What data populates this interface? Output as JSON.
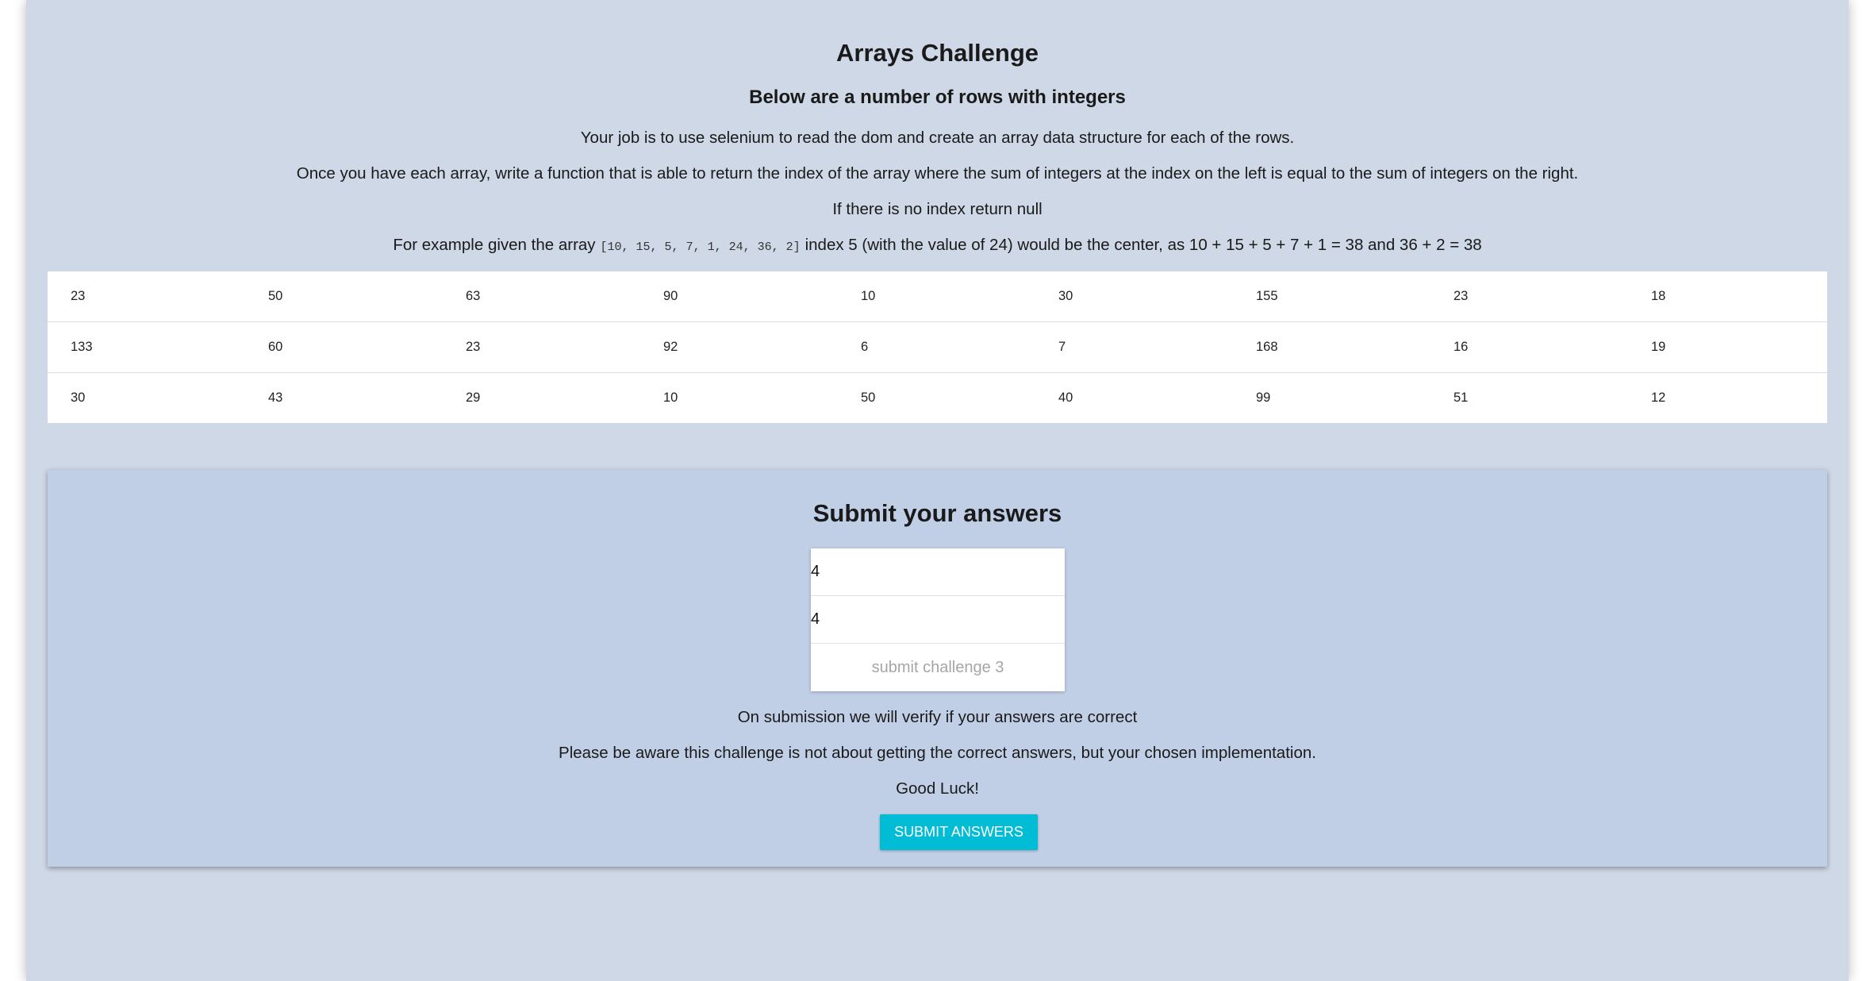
{
  "header": {
    "title": "Arrays Challenge",
    "subtitle": "Below are a number of rows with integers",
    "instruction_1": "Your job is to use selenium to read the dom and create an array data structure for each of the rows.",
    "instruction_2": "Once you have each array, write a function that is able to return the index of the array where the sum of integers at the index on the left is equal to the sum of integers on the right.",
    "instruction_3": "If there is no index return null",
    "example_prefix": "For example given the array",
    "example_array": "[10, 15, 5, 7, 1, 24, 36, 2]",
    "example_suffix": "index 5 (with the value of 24) would be the center, as 10 + 15 + 5 + 7 + 1 = 38 and 36 + 2 = 38"
  },
  "table": {
    "rows": [
      [
        "23",
        "50",
        "63",
        "90",
        "10",
        "30",
        "155",
        "23",
        "18"
      ],
      [
        "133",
        "60",
        "23",
        "92",
        "6",
        "7",
        "168",
        "16",
        "19"
      ],
      [
        "30",
        "43",
        "29",
        "10",
        "50",
        "40",
        "99",
        "51",
        "12"
      ]
    ]
  },
  "submit_panel": {
    "title": "Submit your answers",
    "answer_1": "4",
    "answer_2": "4",
    "submit_challenge_label": "submit challenge 3",
    "note_1": "On submission we will verify if your answers are correct",
    "note_2": "Please be aware this challenge is not about getting the correct answers, but your chosen implementation.",
    "note_3": "Good Luck!",
    "submit_button_label": "SUBMIT ANSWERS"
  },
  "colors": {
    "page_background": "#ced8e6",
    "panel_background": "#c1cfe6",
    "button_accent": "#00bcd4"
  }
}
